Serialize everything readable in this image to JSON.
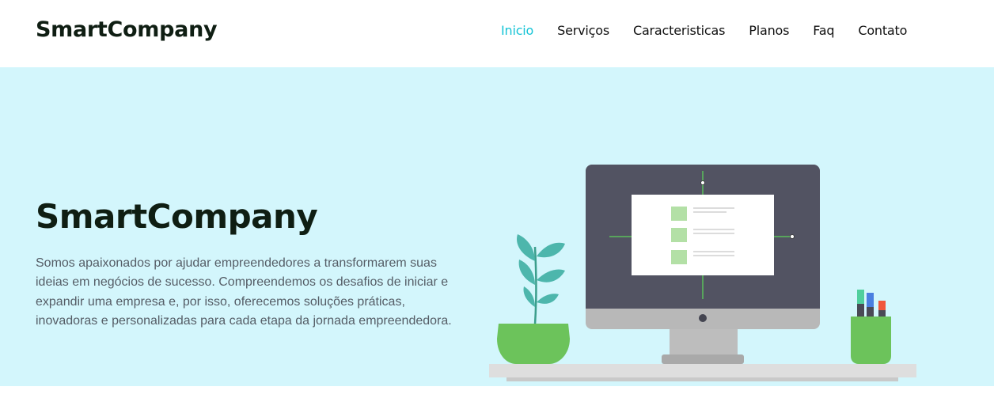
{
  "brand": {
    "name": "SmartCompany"
  },
  "nav": {
    "items": [
      {
        "label": "Inicio",
        "active": true
      },
      {
        "label": "Serviços",
        "active": false
      },
      {
        "label": "Caracteristicas",
        "active": false
      },
      {
        "label": "Planos",
        "active": false
      },
      {
        "label": "Faq",
        "active": false
      },
      {
        "label": "Contato",
        "active": false
      }
    ]
  },
  "hero": {
    "title": "SmartCompany",
    "description": "Somos apaixonados por ajudar empreendedores a transformarem suas ideias em negócios de sucesso. Compreendemos os desafios de iniciar e expandir uma empresa e, por isso, oferecemos soluções práticas, inovadoras e personalizadas para cada etapa da jornada empreendedora."
  },
  "colors": {
    "accent": "#15c4d6",
    "hero_background": "#d3f6fc",
    "heading": "#0f1e13",
    "plant_green": "#6cc35b"
  }
}
